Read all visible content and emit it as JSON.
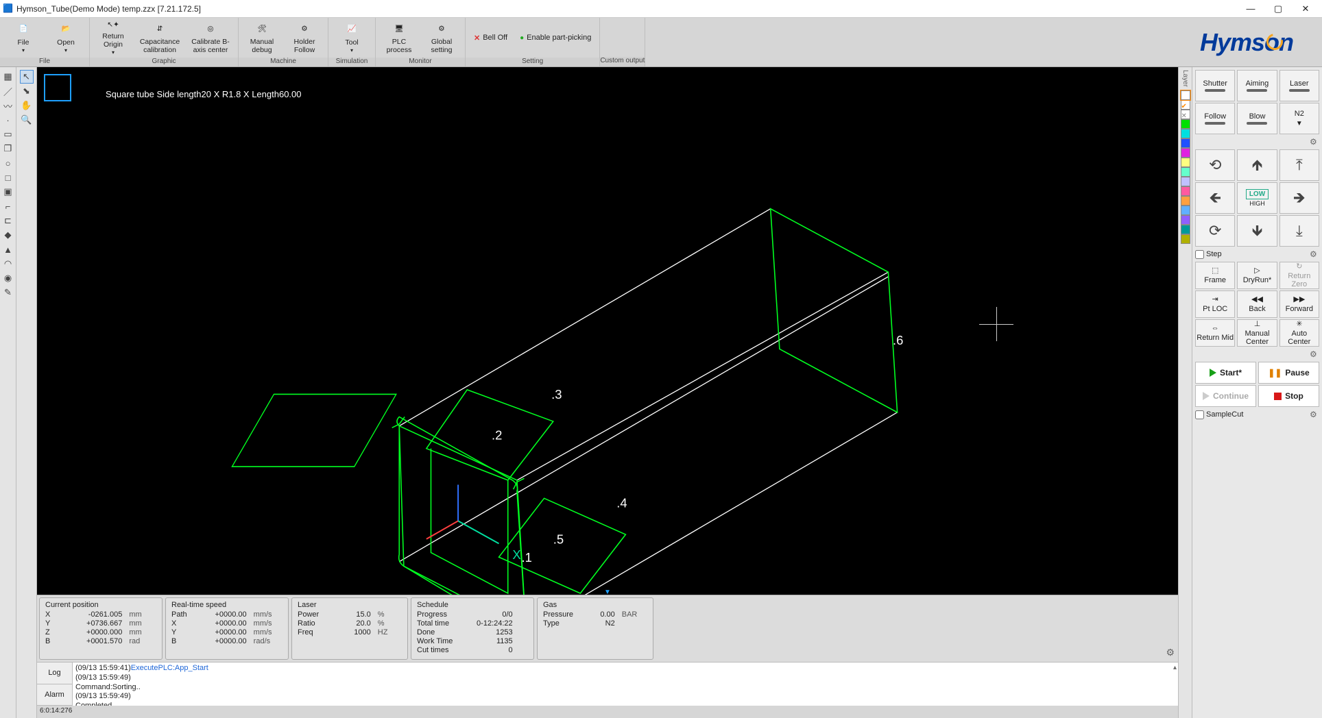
{
  "window": {
    "title": "Hymson_Tube(Demo Mode) temp.zzx  [7.21.172.5]"
  },
  "ribbon": {
    "groups": {
      "file": {
        "label": "File",
        "file": "File",
        "open": "Open"
      },
      "graphic": {
        "label": "Graphic",
        "returnOrigin": "Return Origin",
        "capCal": "Capacitance calibration",
        "calB": "Calibrate B-axis center"
      },
      "machine": {
        "label": "Machine",
        "manualDebug": "Manual debug",
        "holderFollow": "Holder Follow"
      },
      "simulation": {
        "label": "Simulation",
        "tool": "Tool"
      },
      "monitor": {
        "label": "Monitor",
        "plc": "PLC process",
        "global": "Global setting"
      },
      "setting": {
        "label": "Setting",
        "bellOff": "Bell Off",
        "enablePart": "Enable part-picking"
      },
      "custom": {
        "label": "Custom output"
      }
    },
    "brand": "Hymson"
  },
  "viewport": {
    "label": "Square tube Side length20 X R1.8 X Length60.00",
    "nodes": {
      "n1": ".1",
      "n2": ".2",
      "n3": ".3",
      "n4": ".4",
      "n5": ".5",
      "n6": ".6",
      "x": "X"
    }
  },
  "layers": {
    "label": "Layer",
    "colors": [
      "#ffffff",
      "#ffcc66",
      "#ffffff",
      "#00e000",
      "#00e0e0",
      "#2050ff",
      "#e020e0",
      "#ffff80",
      "#66ffcc",
      "#c0c0ff",
      "#ff5aa0",
      "#ffa040",
      "#60b0ff",
      "#905fff",
      "#009999",
      "#b0b000"
    ]
  },
  "rightPanel": {
    "shutter": "Shutter",
    "aiming": "Aiming",
    "laser": "Laser",
    "follow": "Follow",
    "blow": "Blow",
    "gas": "N2",
    "low": "LOW",
    "high": "HIGH",
    "step": "Step",
    "frame": "Frame",
    "dryrun": "DryRun*",
    "returnZero": "Return Zero",
    "ptloc": "Pt LOC",
    "back": "Back",
    "forward": "Forward",
    "returnMid": "Return Mid",
    "manualCenter": "Manual Center",
    "autoCenter": "Auto Center",
    "start": "Start*",
    "pause": "Pause",
    "continue": "Continue",
    "stop": "Stop",
    "sampleCut": "SampleCut"
  },
  "status": {
    "pos": {
      "title": "Current position",
      "rows": [
        {
          "lbl": "X",
          "val": "-0261.005",
          "unit": "mm"
        },
        {
          "lbl": "Y",
          "val": "+0736.667",
          "unit": "mm"
        },
        {
          "lbl": "Z",
          "val": "+0000.000",
          "unit": "mm"
        },
        {
          "lbl": "B",
          "val": "+0001.570",
          "unit": "rad"
        }
      ]
    },
    "speed": {
      "title": "Real-time speed",
      "rows": [
        {
          "lbl": "Path",
          "val": "+0000.00",
          "unit": "mm/s"
        },
        {
          "lbl": "X",
          "val": "+0000.00",
          "unit": "mm/s"
        },
        {
          "lbl": "Y",
          "val": "+0000.00",
          "unit": "mm/s"
        },
        {
          "lbl": "B",
          "val": "+0000.00",
          "unit": "rad/s"
        }
      ]
    },
    "laser": {
      "title": "Laser",
      "rows": [
        {
          "lbl": "Power",
          "val": "15.0",
          "unit": "%"
        },
        {
          "lbl": "Ratio",
          "val": "20.0",
          "unit": "%"
        },
        {
          "lbl": "Freq",
          "val": "1000",
          "unit": "HZ"
        }
      ]
    },
    "sched": {
      "title": "Schedule",
      "rows": [
        {
          "lbl": "Progress",
          "val": "0/0",
          "unit": ""
        },
        {
          "lbl": "Total time",
          "val": "0-12:24:22",
          "unit": ""
        },
        {
          "lbl": "Done",
          "val": "1253",
          "unit": ""
        },
        {
          "lbl": "Work Time",
          "val": "1135",
          "unit": ""
        },
        {
          "lbl": "Cut times",
          "val": "0",
          "unit": ""
        }
      ]
    },
    "gas": {
      "title": "Gas",
      "rows": [
        {
          "lbl": "Pressure",
          "val": "0.00",
          "unit": "BAR"
        },
        {
          "lbl": "Type",
          "val": "N2",
          "unit": ""
        }
      ]
    }
  },
  "log": {
    "tabLog": "Log",
    "tabAlarm": "Alarm",
    "lines": [
      {
        "ts": "(09/13 15:59:41)",
        "txt": "ExecutePLC:App_Start",
        "cls": "exec"
      },
      {
        "ts": "(09/13 15:59:49)",
        "txt": "",
        "cls": ""
      },
      {
        "ts": "",
        "txt": "Command:Sorting..",
        "cls": ""
      },
      {
        "ts": "(09/13 15:59:49)",
        "txt": "",
        "cls": ""
      },
      {
        "ts": "",
        "txt": "Completed",
        "cls": ""
      }
    ]
  },
  "footer": {
    "left": "6:0:14:276"
  }
}
